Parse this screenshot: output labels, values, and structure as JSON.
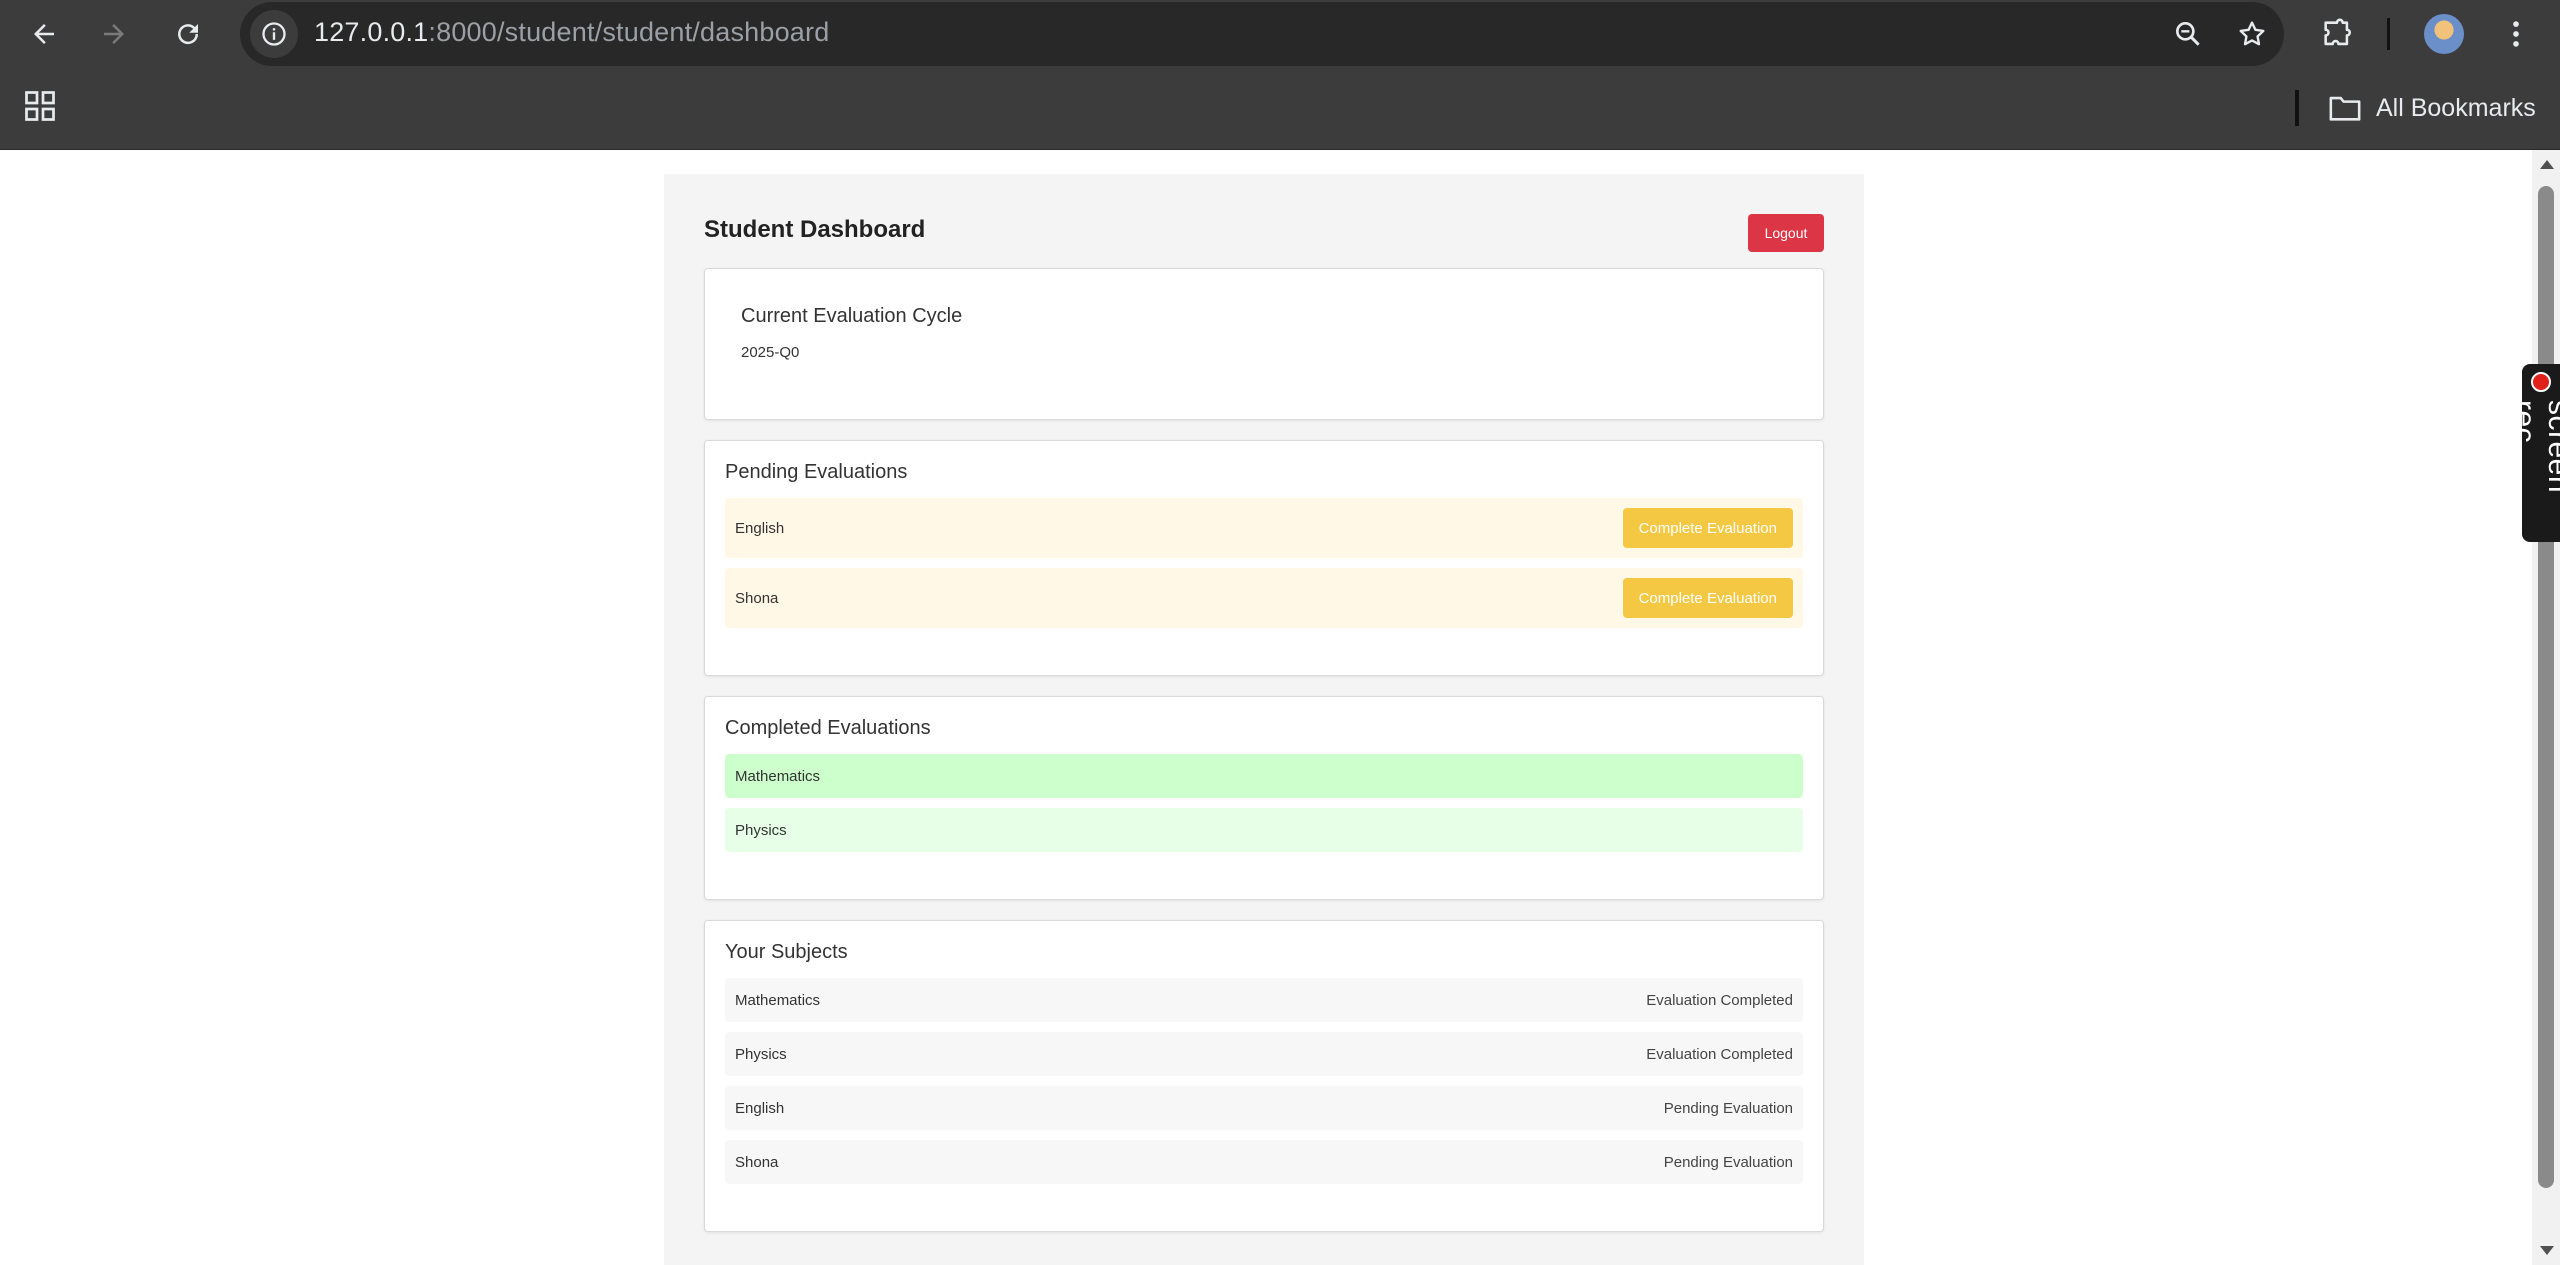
{
  "browser": {
    "url_host": "127.0.0.1",
    "url_path": ":8000/student/student/dashboard",
    "bookmarks_label": "All Bookmarks",
    "extension_label": "screen rec"
  },
  "page": {
    "title": "Student Dashboard",
    "logout_label": "Logout",
    "cycle": {
      "title": "Current Evaluation Cycle",
      "value": "2025-Q0"
    },
    "pending": {
      "title": "Pending Evaluations",
      "items": [
        {
          "subject": "English",
          "action": "Complete Evaluation"
        },
        {
          "subject": "Shona",
          "action": "Complete Evaluation"
        }
      ]
    },
    "completed": {
      "title": "Completed Evaluations",
      "items": [
        "Mathematics",
        "Physics"
      ]
    },
    "subjects": {
      "title": "Your Subjects",
      "items": [
        {
          "name": "Mathematics",
          "status": "Evaluation Completed"
        },
        {
          "name": "Physics",
          "status": "Evaluation Completed"
        },
        {
          "name": "English",
          "status": "Pending Evaluation"
        },
        {
          "name": "Shona",
          "status": "Pending Evaluation"
        }
      ]
    }
  },
  "colors": {
    "logout": "#dc3545",
    "complete_button": "#f4c842",
    "pending_row": "#fff8e6",
    "completed_row_1": "#ccffcc",
    "completed_row_2": "#e6ffe6"
  }
}
